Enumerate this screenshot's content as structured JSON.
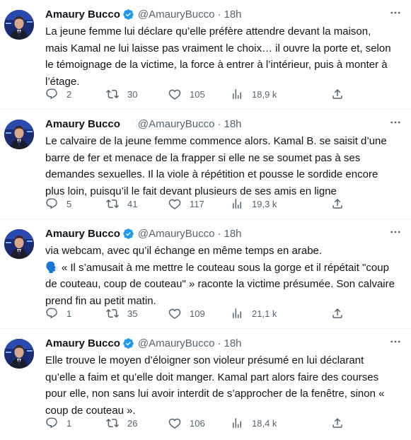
{
  "colors": {
    "text": "#0f1419",
    "secondary": "#536471",
    "verified": "#1d9bf0",
    "divider": "#eff3f4"
  },
  "tweets": [
    {
      "author_name": "Amaury Bucco",
      "handle": "@AmauryBucco",
      "separator": "·",
      "time": "18h",
      "text": "La jeune femme lui déclare qu’elle préfère attendre devant la maison,\nmais Kamal ne lui laisse pas vraiment le choix… il ouvre la porte et, selon\nle témoignage de la victime, la force à entrer à l’intérieur, puis à monter à\nl’étage.",
      "replies": "2",
      "retweets": "30",
      "likes": "105",
      "views": "18,9 k"
    },
    {
      "author_name": "Amaury Bucco",
      "handle": "@AmauryBucco",
      "separator": "·",
      "time": "18h",
      "text": "Le calvaire de la jeune femme commence alors. Kamal B. se saisit d’une\nbarre de fer et menace de la frapper si elle ne se soumet pas à ses\ndemandes sexuelles. Il la viole à répétition et pousse le sordide encore\nplus loin, puisqu’il le fait devant plusieurs de ses amis en ligne",
      "replies": "5",
      "retweets": "41",
      "likes": "117",
      "views": "19,3 k"
    },
    {
      "author_name": "Amaury Bucco",
      "handle": "@AmauryBucco",
      "separator": "·",
      "time": "18h",
      "text": "via webcam, avec qu’il échange en même temps en arabe.\n🗣️ « Il s’amusait à me mettre le couteau sous la gorge et il répétait \"coup\nde couteau, coup de couteau\" » raconte la victime présumée. Son calvaire\nprend fin au petit matin.",
      "replies": "1",
      "retweets": "35",
      "likes": "109",
      "views": "21,1 k"
    },
    {
      "author_name": "Amaury Bucco",
      "handle": "@AmauryBucco",
      "separator": "·",
      "time": "18h",
      "text": "Elle trouve le moyen d’éloigner son violeur présumé en lui déclarant\nqu’elle a faim et qu’elle doit manger. Kamal part alors faire des courses\npour elle, non sans lui avoir interdit de s’approcher de la fenêtre, sinon «\ncoup de couteau ».",
      "replies": "1",
      "retweets": "26",
      "likes": "106",
      "views": "18,4 k"
    }
  ]
}
